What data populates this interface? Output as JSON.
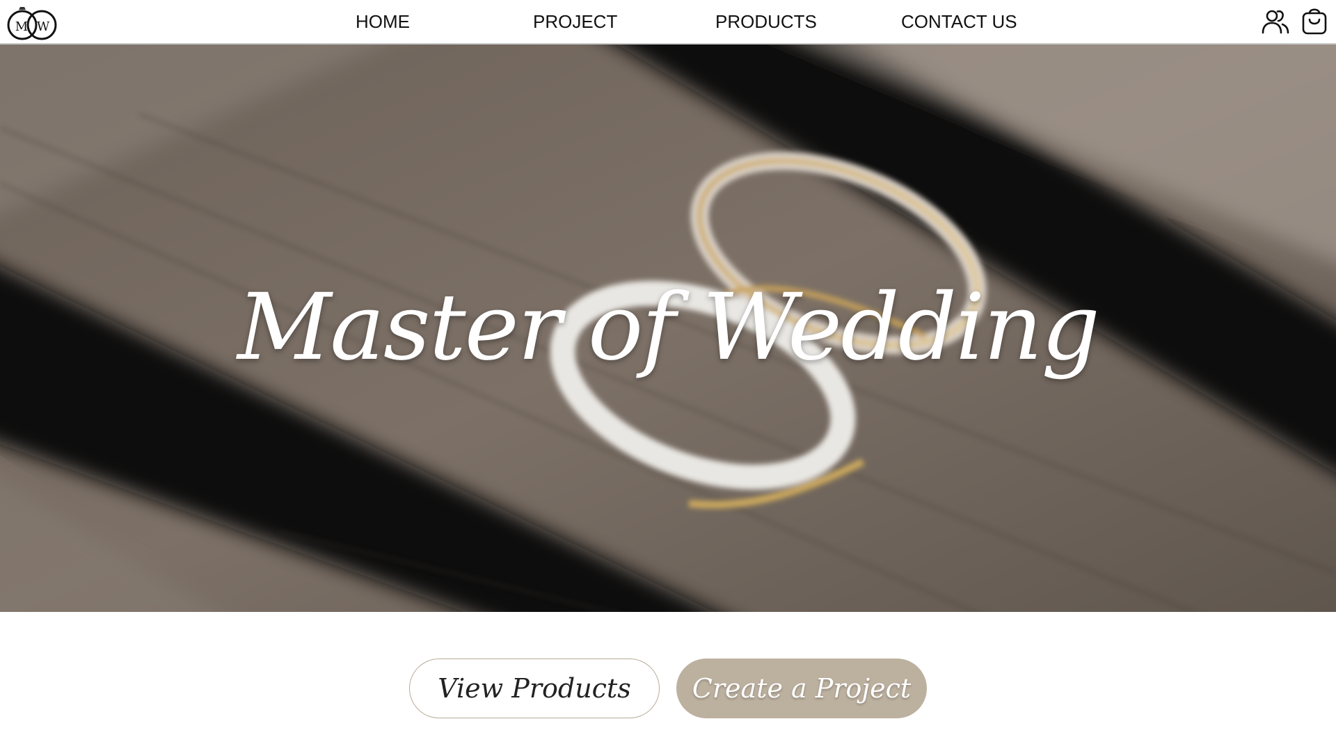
{
  "brand": {
    "logo_letters": "MW"
  },
  "nav": {
    "items": [
      {
        "label": "HOME"
      },
      {
        "label": "PROJECT"
      },
      {
        "label": "PRODUCTS"
      },
      {
        "label": "CONTACT US"
      }
    ]
  },
  "header_icons": {
    "account": "users-icon",
    "cart": "shopping-bag-icon"
  },
  "hero": {
    "title": "Master of Wedding"
  },
  "actions": {
    "view_products": "View Products",
    "create_project": "Create a Project"
  },
  "colors": {
    "accent_button": "#bcb09f",
    "outline_border": "#b7aa99",
    "text": "#111111"
  }
}
